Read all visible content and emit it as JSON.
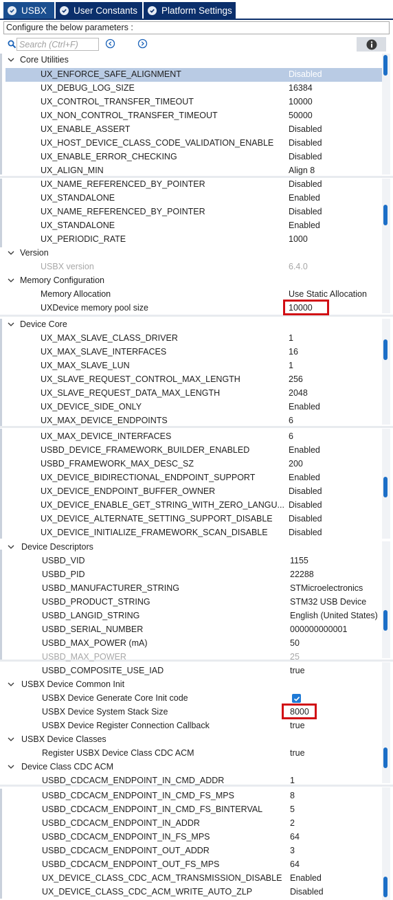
{
  "tabs": [
    {
      "label": "USBX",
      "active": true
    },
    {
      "label": "User Constants",
      "active": false
    },
    {
      "label": "Platform Settings",
      "active": false
    }
  ],
  "config_header": "Configure the below parameters :",
  "search": {
    "placeholder": "Search (Ctrl+F)"
  },
  "colors": {
    "tab_bg": "#0b2f6b",
    "selected_row": "#b9cbe4",
    "highlight_box": "#d10d14",
    "scroll_thumb": "#1c6fc7"
  },
  "groups": {
    "core_utilities": {
      "label": "Core Utilities",
      "items": [
        {
          "name": "UX_ENFORCE_SAFE_ALIGNMENT",
          "value": "Disabled"
        },
        {
          "name": "UX_DEBUG_LOG_SIZE",
          "value": "16384"
        },
        {
          "name": "UX_CONTROL_TRANSFER_TIMEOUT",
          "value": "10000"
        },
        {
          "name": "UX_NON_CONTROL_TRANSFER_TIMEOUT",
          "value": "50000"
        },
        {
          "name": "UX_ENABLE_ASSERT",
          "value": "Disabled"
        },
        {
          "name": "UX_HOST_DEVICE_CLASS_CODE_VALIDATION_ENABLE",
          "value": "Disabled"
        },
        {
          "name": "UX_ENABLE_ERROR_CHECKING",
          "value": "Disabled"
        },
        {
          "name": "UX_ALIGN_MIN",
          "value": "Align 8"
        },
        {
          "name": "UX_NAME_REFERENCED_BY_POINTER",
          "value": "Disabled"
        },
        {
          "name": "UX_STANDALONE",
          "value": "Enabled"
        },
        {
          "name": "UX_NAME_REFERENCED_BY_POINTER",
          "value": "Disabled"
        },
        {
          "name": "UX_STANDALONE",
          "value": "Enabled"
        },
        {
          "name": "UX_PERIODIC_RATE",
          "value": "1000"
        }
      ]
    },
    "version": {
      "label": "Version",
      "items": [
        {
          "name": "USBX version",
          "value": "6.4.0"
        }
      ]
    },
    "memory": {
      "label": "Memory Configuration",
      "items": [
        {
          "name": "Memory Allocation",
          "value": "Use Static Allocation"
        },
        {
          "name": "UXDevice memory pool size",
          "value": "10000"
        }
      ]
    },
    "device_core": {
      "label": "Device Core",
      "items": [
        {
          "name": "UX_MAX_SLAVE_CLASS_DRIVER",
          "value": "1"
        },
        {
          "name": "UX_MAX_SLAVE_INTERFACES",
          "value": "16"
        },
        {
          "name": "UX_MAX_SLAVE_LUN",
          "value": "1"
        },
        {
          "name": "UX_SLAVE_REQUEST_CONTROL_MAX_LENGTH",
          "value": "256"
        },
        {
          "name": "UX_SLAVE_REQUEST_DATA_MAX_LENGTH",
          "value": "2048"
        },
        {
          "name": "UX_DEVICE_SIDE_ONLY",
          "value": "Enabled"
        },
        {
          "name": "UX_MAX_DEVICE_ENDPOINTS",
          "value": "6"
        },
        {
          "name": "UX_MAX_DEVICE_INTERFACES",
          "value": "6"
        },
        {
          "name": "USBD_DEVICE_FRAMEWORK_BUILDER_ENABLED",
          "value": "Enabled"
        },
        {
          "name": "USBD_FRAMEWORK_MAX_DESC_SZ",
          "value": "200"
        },
        {
          "name": "UX_DEVICE_BIDIRECTIONAL_ENDPOINT_SUPPORT",
          "value": "Enabled"
        },
        {
          "name": "UX_DEVICE_ENDPOINT_BUFFER_OWNER",
          "value": "Disabled"
        },
        {
          "name": "UX_DEVICE_ENABLE_GET_STRING_WITH_ZERO_LANGU...",
          "value": "Disabled"
        },
        {
          "name": "UX_DEVICE_ALTERNATE_SETTING_SUPPORT_DISABLE",
          "value": "Disabled"
        },
        {
          "name": "UX_DEVICE_INITIALIZE_FRAMEWORK_SCAN_DISABLE",
          "value": "Disabled"
        }
      ]
    },
    "descriptors": {
      "label": "Device Descriptors",
      "items": [
        {
          "name": "USBD_VID",
          "value": "1155"
        },
        {
          "name": "USBD_PID",
          "value": "22288"
        },
        {
          "name": "USBD_MANUFACTURER_STRING",
          "value": "STMicroelectronics"
        },
        {
          "name": "USBD_PRODUCT_STRING",
          "value": "STM32 USB Device"
        },
        {
          "name": "USBD_LANGID_STRING",
          "value": "English (United States)"
        },
        {
          "name": "USBD_SERIAL_NUMBER",
          "value": "000000000001"
        },
        {
          "name": "USBD_MAX_POWER (mA)",
          "value": "50"
        },
        {
          "name": "USBD_MAX_POWER",
          "value": "25"
        },
        {
          "name": "USBD_COMPOSITE_USE_IAD",
          "value": "true"
        }
      ]
    },
    "common_init": {
      "label": "USBX Device Common Init",
      "items": [
        {
          "name": "USBX Device Generate Core Init code",
          "value": ""
        },
        {
          "name": "USBX Device System Stack Size",
          "value": "8000"
        },
        {
          "name": "USBX Device Register Connection Callback",
          "value": "true"
        }
      ]
    },
    "classes": {
      "label": "USBX Device Classes",
      "items": [
        {
          "name": "Register USBX Device Class CDC ACM",
          "value": "true"
        }
      ]
    },
    "cdc_acm": {
      "label": "Device Class CDC ACM",
      "items": [
        {
          "name": "USBD_CDCACM_ENDPOINT_IN_CMD_ADDR",
          "value": "1"
        },
        {
          "name": "USBD_CDCACM_ENDPOINT_IN_CMD_FS_MPS",
          "value": "8"
        },
        {
          "name": "USBD_CDCACM_ENDPOINT_IN_CMD_FS_BINTERVAL",
          "value": "5"
        },
        {
          "name": "USBD_CDCACM_ENDPOINT_IN_ADDR",
          "value": "2"
        },
        {
          "name": "USBD_CDCACM_ENDPOINT_IN_FS_MPS",
          "value": "64"
        },
        {
          "name": "USBD_CDCACM_ENDPOINT_OUT_ADDR",
          "value": "3"
        },
        {
          "name": "USBD_CDCACM_ENDPOINT_OUT_FS_MPS",
          "value": "64"
        },
        {
          "name": "UX_DEVICE_CLASS_CDC_ACM_TRANSMISSION_DISABLE",
          "value": "Enabled"
        },
        {
          "name": "UX_DEVICE_CLASS_CDC_ACM_WRITE_AUTO_ZLP",
          "value": "Disabled"
        }
      ]
    }
  }
}
